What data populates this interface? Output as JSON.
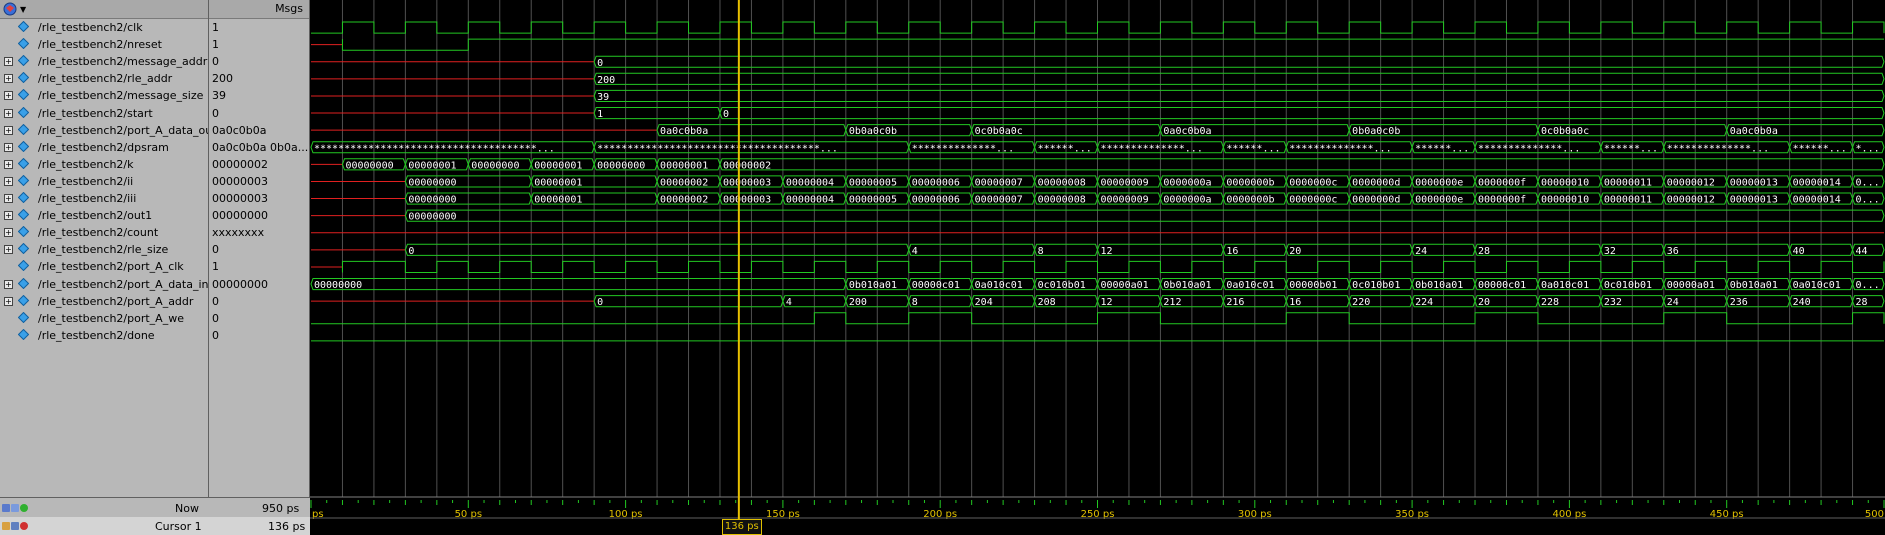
{
  "values_header": "Msgs",
  "signals": [
    {
      "name": "/rle_testbench2/clk",
      "value": "1",
      "expandable": false
    },
    {
      "name": "/rle_testbench2/nreset",
      "value": "1",
      "expandable": false
    },
    {
      "name": "/rle_testbench2/message_addr",
      "value": "0",
      "expandable": true
    },
    {
      "name": "/rle_testbench2/rle_addr",
      "value": "200",
      "expandable": true
    },
    {
      "name": "/rle_testbench2/message_size",
      "value": "39",
      "expandable": true
    },
    {
      "name": "/rle_testbench2/start",
      "value": "0",
      "expandable": true
    },
    {
      "name": "/rle_testbench2/port_A_data_out",
      "value": "0a0c0b0a",
      "expandable": true
    },
    {
      "name": "/rle_testbench2/dpsram",
      "value": "0a0c0b0a 0b0a...",
      "expandable": true
    },
    {
      "name": "/rle_testbench2/k",
      "value": "00000002",
      "expandable": true
    },
    {
      "name": "/rle_testbench2/ii",
      "value": "00000003",
      "expandable": true
    },
    {
      "name": "/rle_testbench2/iii",
      "value": "00000003",
      "expandable": true
    },
    {
      "name": "/rle_testbench2/out1",
      "value": "00000000",
      "expandable": true
    },
    {
      "name": "/rle_testbench2/count",
      "value": "xxxxxxxx",
      "expandable": true
    },
    {
      "name": "/rle_testbench2/rle_size",
      "value": "0",
      "expandable": true
    },
    {
      "name": "/rle_testbench2/port_A_clk",
      "value": "1",
      "expandable": false
    },
    {
      "name": "/rle_testbench2/port_A_data_in",
      "value": "00000000",
      "expandable": true
    },
    {
      "name": "/rle_testbench2/port_A_addr",
      "value": "0",
      "expandable": true
    },
    {
      "name": "/rle_testbench2/port_A_we",
      "value": "0",
      "expandable": false
    },
    {
      "name": "/rle_testbench2/done",
      "value": "0",
      "expandable": false
    }
  ],
  "status": {
    "now_label": "Now",
    "now_value": "950 ps",
    "cursor_label": "Cursor 1",
    "cursor_value": "136 ps",
    "cursor_tag": "136 ps"
  },
  "timeline": {
    "labels": [
      "ps",
      "50 ps",
      "100 ps",
      "150 ps",
      "200 ps",
      "250 ps",
      "300 ps",
      "350 ps",
      "400 ps",
      "450 ps",
      "500"
    ],
    "label_times": [
      0,
      50,
      100,
      150,
      200,
      250,
      300,
      350,
      400,
      450,
      500
    ],
    "cursor_time": 136,
    "visible_range": [
      0,
      500
    ]
  },
  "colors": {
    "wave": "#22c822",
    "undriven": "#e02020",
    "grid": "#505050",
    "cursor": "#e8c000",
    "text": "#ffffff"
  },
  "waves": {
    "clk": {
      "initial": 0,
      "toggles": [
        10,
        20,
        30,
        40,
        50,
        60,
        70,
        80,
        90,
        100,
        110,
        120,
        130,
        140,
        150,
        160,
        170,
        180,
        190,
        200,
        210,
        220,
        230,
        240,
        250,
        260,
        270,
        280,
        290,
        300,
        310,
        320,
        330,
        340,
        350,
        360,
        370,
        380,
        390,
        400,
        410,
        420,
        430,
        440,
        450,
        460,
        470,
        480,
        490,
        500
      ]
    },
    "nreset": {
      "undriven_until": 10,
      "initial": 1,
      "toggles": [
        10,
        50
      ]
    },
    "message_addr": {
      "undriven_until": 90,
      "segments": [
        {
          "t": 90,
          "v": "0"
        }
      ]
    },
    "rle_addr": {
      "undriven_until": 90,
      "segments": [
        {
          "t": 90,
          "v": "200"
        }
      ]
    },
    "message_size": {
      "undriven_until": 90,
      "segments": [
        {
          "t": 90,
          "v": "39"
        }
      ]
    },
    "start": {
      "undriven_until": 90,
      "segments": [
        {
          "t": 90,
          "v": "1"
        },
        {
          "t": 130,
          "v": "0"
        }
      ]
    },
    "port_A_data_out": {
      "undriven_until": 110,
      "segments": [
        {
          "t": 110,
          "v": "0a0c0b0a"
        },
        {
          "t": 170,
          "v": "0b0a0c0b"
        },
        {
          "t": 210,
          "v": "0c0b0a0c"
        },
        {
          "t": 270,
          "v": "0a0c0b0a"
        },
        {
          "t": 330,
          "v": "0b0a0c0b"
        },
        {
          "t": 390,
          "v": "0c0b0a0c"
        },
        {
          "t": 450,
          "v": "0a0c0b0a"
        }
      ]
    },
    "dpsram": {
      "segments": [
        {
          "t": 0,
          "v": "*************************************..."
        },
        {
          "t": 90,
          "v": "*************************************..."
        },
        {
          "t": 190,
          "v": "**************..."
        },
        {
          "t": 230,
          "v": "*******..."
        },
        {
          "t": 250,
          "v": "**************..."
        },
        {
          "t": 290,
          "v": "*******..."
        },
        {
          "t": 310,
          "v": "**************..."
        },
        {
          "t": 350,
          "v": "*******..."
        },
        {
          "t": 370,
          "v": "**************..."
        },
        {
          "t": 410,
          "v": "*******..."
        },
        {
          "t": 430,
          "v": "**************..."
        },
        {
          "t": 470,
          "v": "*******..."
        },
        {
          "t": 490,
          "v": "**..."
        }
      ]
    },
    "k": {
      "undriven_until": 10,
      "segments": [
        {
          "t": 10,
          "v": "00000000"
        },
        {
          "t": 30,
          "v": "00000001"
        },
        {
          "t": 50,
          "v": "00000000"
        },
        {
          "t": 70,
          "v": "00000001"
        },
        {
          "t": 90,
          "v": "00000000"
        },
        {
          "t": 110,
          "v": "00000001"
        },
        {
          "t": 130,
          "v": "00000002"
        }
      ]
    },
    "ii": {
      "undriven_until": 30,
      "segments": [
        {
          "t": 30,
          "v": "00000000"
        },
        {
          "t": 70,
          "v": "00000001"
        },
        {
          "t": 110,
          "v": "00000002"
        },
        {
          "t": 130,
          "v": "00000003"
        },
        {
          "t": 150,
          "v": "00000004"
        },
        {
          "t": 170,
          "v": "00000005"
        },
        {
          "t": 190,
          "v": "00000006"
        },
        {
          "t": 210,
          "v": "00000007"
        },
        {
          "t": 230,
          "v": "00000008"
        },
        {
          "t": 250,
          "v": "00000009"
        },
        {
          "t": 270,
          "v": "0000000a"
        },
        {
          "t": 290,
          "v": "0000000b"
        },
        {
          "t": 310,
          "v": "0000000c"
        },
        {
          "t": 330,
          "v": "0000000d"
        },
        {
          "t": 350,
          "v": "0000000e"
        },
        {
          "t": 370,
          "v": "0000000f"
        },
        {
          "t": 390,
          "v": "00000010"
        },
        {
          "t": 410,
          "v": "00000011"
        },
        {
          "t": 430,
          "v": "00000012"
        },
        {
          "t": 450,
          "v": "00000013"
        },
        {
          "t": 470,
          "v": "00000014"
        },
        {
          "t": 490,
          "v": "00..."
        }
      ]
    },
    "iii": {
      "undriven_until": 30,
      "segments": [
        {
          "t": 30,
          "v": "00000000"
        },
        {
          "t": 70,
          "v": "00000001"
        },
        {
          "t": 110,
          "v": "00000002"
        },
        {
          "t": 130,
          "v": "00000003"
        },
        {
          "t": 150,
          "v": "00000004"
        },
        {
          "t": 170,
          "v": "00000005"
        },
        {
          "t": 190,
          "v": "00000006"
        },
        {
          "t": 210,
          "v": "00000007"
        },
        {
          "t": 230,
          "v": "00000008"
        },
        {
          "t": 250,
          "v": "00000009"
        },
        {
          "t": 270,
          "v": "0000000a"
        },
        {
          "t": 290,
          "v": "0000000b"
        },
        {
          "t": 310,
          "v": "0000000c"
        },
        {
          "t": 330,
          "v": "0000000d"
        },
        {
          "t": 350,
          "v": "0000000e"
        },
        {
          "t": 370,
          "v": "0000000f"
        },
        {
          "t": 390,
          "v": "00000010"
        },
        {
          "t": 410,
          "v": "00000011"
        },
        {
          "t": 430,
          "v": "00000012"
        },
        {
          "t": 450,
          "v": "00000013"
        },
        {
          "t": 470,
          "v": "00000014"
        },
        {
          "t": 490,
          "v": "00..."
        }
      ]
    },
    "out1": {
      "undriven_until": 30,
      "segments": [
        {
          "t": 30,
          "v": "00000000"
        }
      ]
    },
    "count": {
      "undriven_until": 500,
      "segments": []
    },
    "rle_size": {
      "undriven_until": 30,
      "segments": [
        {
          "t": 30,
          "v": "0"
        },
        {
          "t": 190,
          "v": "4"
        },
        {
          "t": 230,
          "v": "8"
        },
        {
          "t": 250,
          "v": "12"
        },
        {
          "t": 290,
          "v": "16"
        },
        {
          "t": 310,
          "v": "20"
        },
        {
          "t": 350,
          "v": "24"
        },
        {
          "t": 370,
          "v": "28"
        },
        {
          "t": 410,
          "v": "32"
        },
        {
          "t": 430,
          "v": "36"
        },
        {
          "t": 470,
          "v": "40"
        },
        {
          "t": 490,
          "v": "44"
        }
      ]
    },
    "port_A_clk": {
      "undriven_until": 10,
      "initial": 0,
      "toggles": [
        10,
        30,
        40,
        50,
        60,
        70,
        80,
        90,
        100,
        110,
        120,
        130,
        140,
        150,
        160,
        170,
        180,
        190,
        200,
        210,
        220,
        230,
        240,
        250,
        260,
        270,
        280,
        290,
        300,
        310,
        320,
        330,
        340,
        350,
        360,
        370,
        380,
        390,
        400,
        410,
        420,
        430,
        440,
        450,
        460,
        470,
        480,
        490,
        500
      ]
    },
    "port_A_data_in": {
      "segments": [
        {
          "t": 0,
          "v": "00000000"
        },
        {
          "t": 170,
          "v": "0b010a01"
        },
        {
          "t": 190,
          "v": "00000c01"
        },
        {
          "t": 210,
          "v": "0a010c01"
        },
        {
          "t": 230,
          "v": "0c010b01"
        },
        {
          "t": 250,
          "v": "00000a01"
        },
        {
          "t": 270,
          "v": "0b010a01"
        },
        {
          "t": 290,
          "v": "0a010c01"
        },
        {
          "t": 310,
          "v": "00000b01"
        },
        {
          "t": 330,
          "v": "0c010b01"
        },
        {
          "t": 350,
          "v": "0b010a01"
        },
        {
          "t": 370,
          "v": "00000c01"
        },
        {
          "t": 390,
          "v": "0a010c01"
        },
        {
          "t": 410,
          "v": "0c010b01"
        },
        {
          "t": 430,
          "v": "00000a01"
        },
        {
          "t": 450,
          "v": "0b010a01"
        },
        {
          "t": 470,
          "v": "0a010c01"
        },
        {
          "t": 490,
          "v": "00..."
        }
      ]
    },
    "port_A_addr": {
      "undriven_until": 90,
      "segments": [
        {
          "t": 90,
          "v": "0"
        },
        {
          "t": 150,
          "v": "4"
        },
        {
          "t": 170,
          "v": "200"
        },
        {
          "t": 190,
          "v": "8"
        },
        {
          "t": 210,
          "v": "204"
        },
        {
          "t": 230,
          "v": "208"
        },
        {
          "t": 250,
          "v": "12"
        },
        {
          "t": 270,
          "v": "212"
        },
        {
          "t": 290,
          "v": "216"
        },
        {
          "t": 310,
          "v": "16"
        },
        {
          "t": 330,
          "v": "220"
        },
        {
          "t": 350,
          "v": "224"
        },
        {
          "t": 370,
          "v": "20"
        },
        {
          "t": 390,
          "v": "228"
        },
        {
          "t": 410,
          "v": "232"
        },
        {
          "t": 430,
          "v": "24"
        },
        {
          "t": 450,
          "v": "236"
        },
        {
          "t": 470,
          "v": "240"
        },
        {
          "t": 490,
          "v": "28"
        }
      ]
    },
    "port_A_we": {
      "initial": 0,
      "toggles": [
        160,
        170,
        190,
        210,
        250,
        270,
        310,
        330,
        370,
        390,
        430,
        450,
        490,
        500
      ]
    },
    "done": {
      "initial": 0,
      "toggles": []
    }
  }
}
